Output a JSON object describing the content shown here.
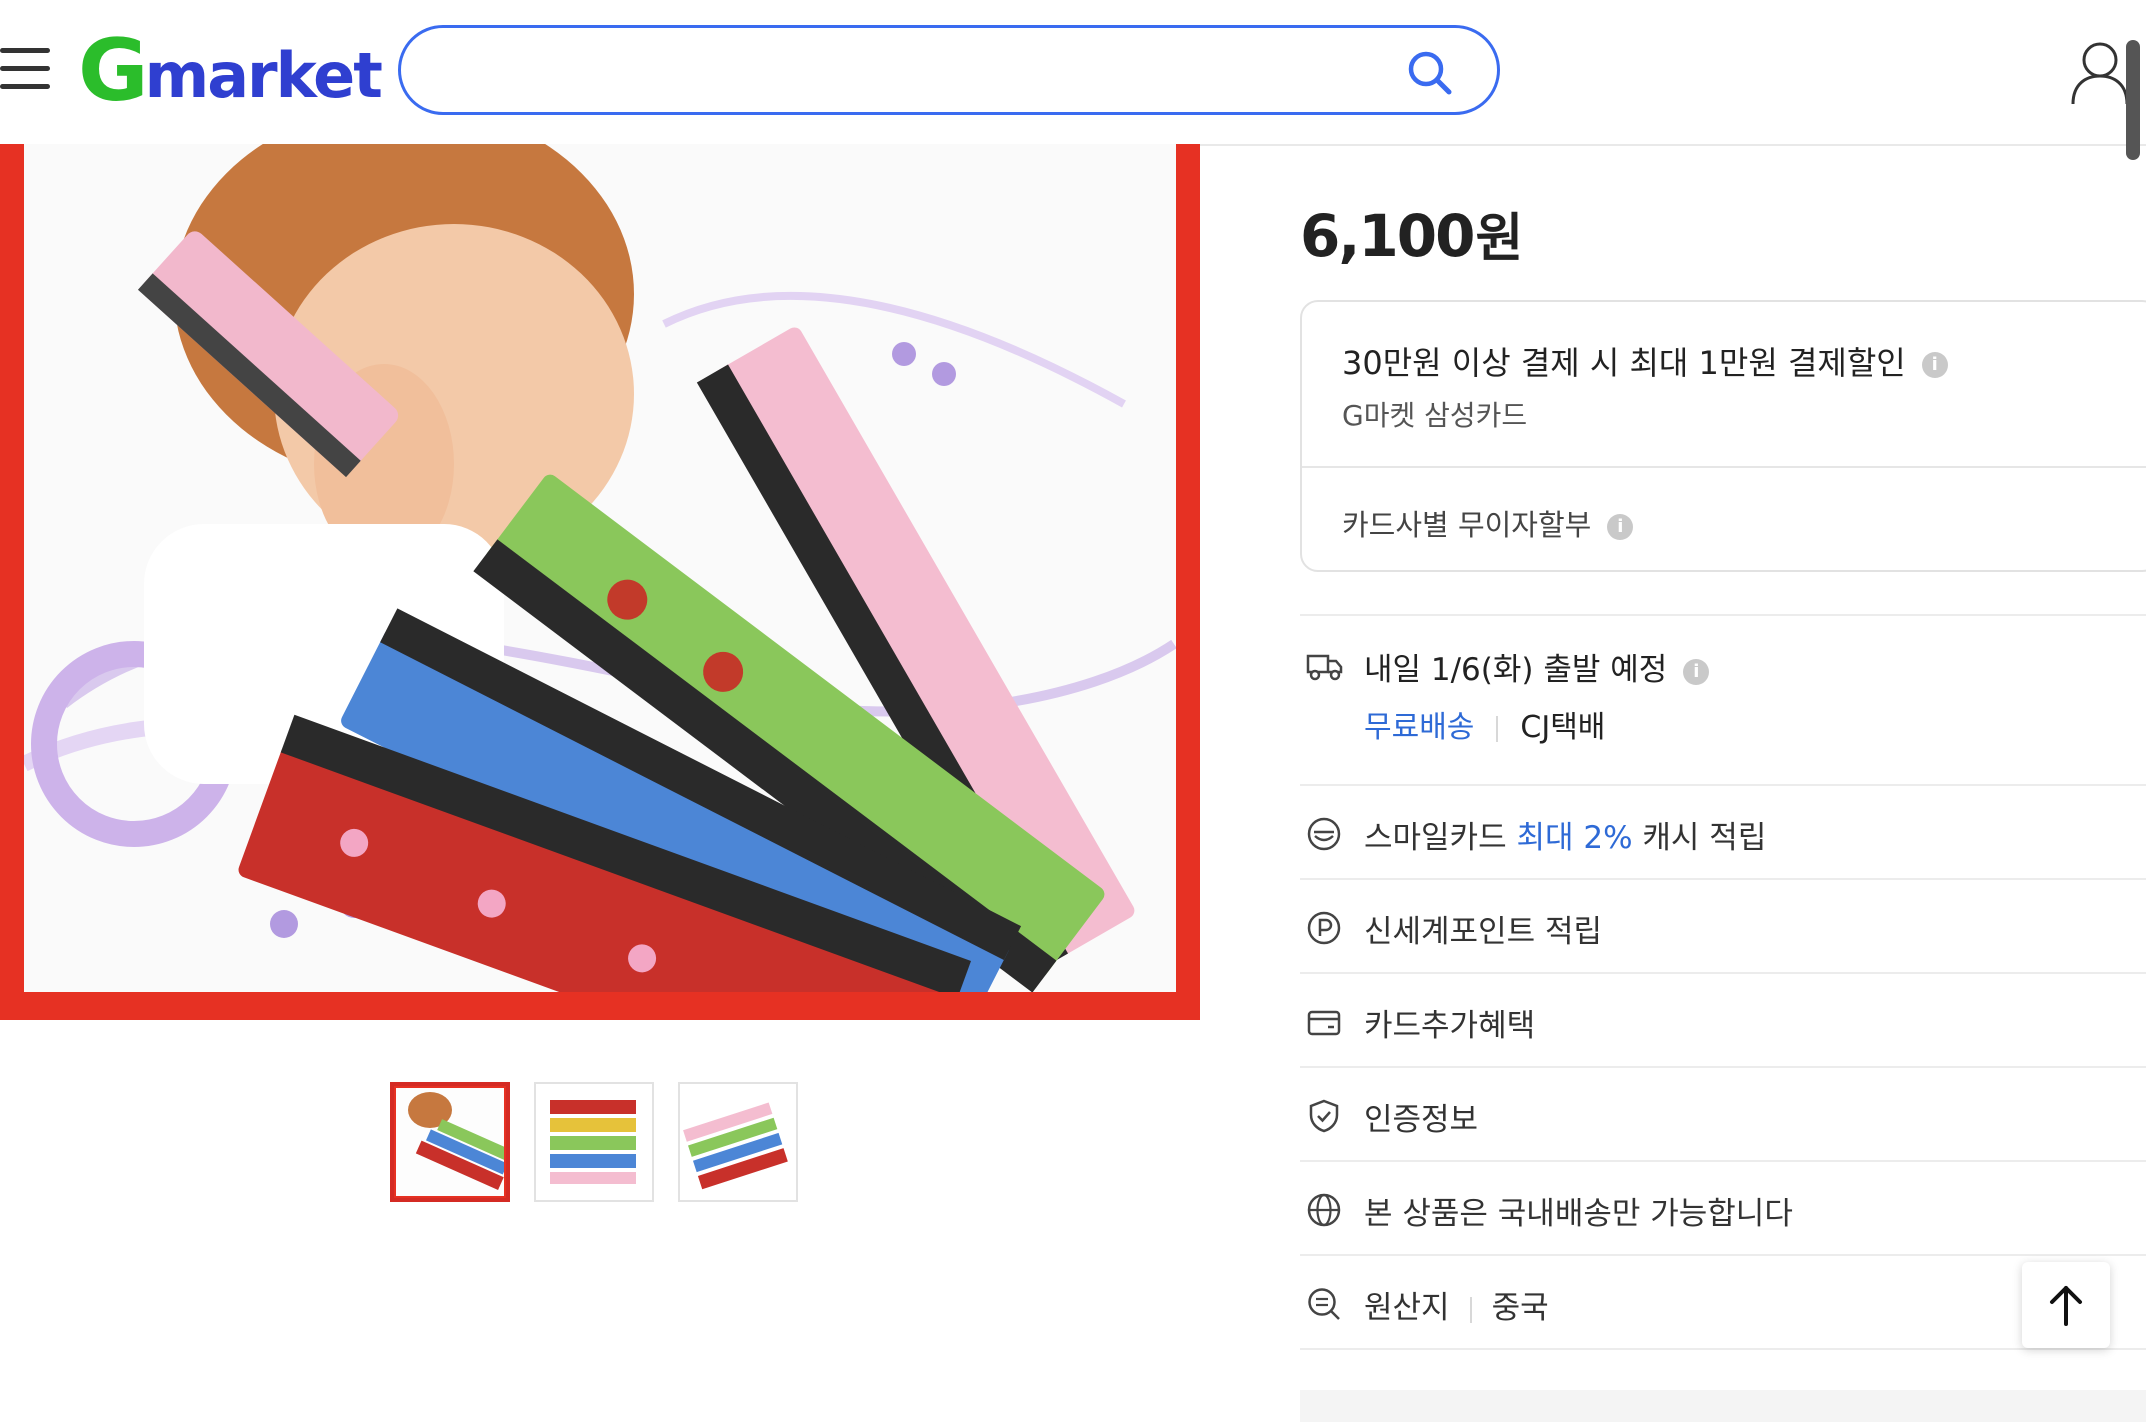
{
  "header": {
    "logo_g": "G",
    "logo_rest": "market",
    "search_placeholder": "",
    "search_value": ""
  },
  "product": {
    "price": "6,100",
    "currency": "원"
  },
  "card_promo": {
    "title": "30만원 이상 결제 시 최대 1만원 결제할인",
    "subtitle": "G마켓 삼성카드",
    "installment": "카드사별 무이자할부",
    "info_glyph": "i"
  },
  "shipping": {
    "title": "내일 1/6(화) 출발 예정",
    "free_label": "무료배송",
    "carrier": "CJ택배"
  },
  "benefits": [
    {
      "icon": "smile-card-icon",
      "prefix": "스마일카드 ",
      "highlight": "최대 2%",
      "suffix": " 캐시 적립"
    },
    {
      "icon": "point-icon",
      "prefix": "신세계포인트 적립",
      "highlight": "",
      "suffix": ""
    },
    {
      "icon": "card-icon",
      "prefix": "카드추가혜택",
      "highlight": "",
      "suffix": ""
    },
    {
      "icon": "shield-check-icon",
      "prefix": "인증정보",
      "highlight": "",
      "suffix": ""
    },
    {
      "icon": "globe-icon",
      "prefix": "본 상품은 국내배송만 가능합니다",
      "highlight": "",
      "suffix": ""
    }
  ],
  "origin": {
    "label": "원산지",
    "value": "중국"
  },
  "colors": {
    "accent_blue": "#2e6ad6",
    "search_border": "#3a6bf0",
    "logo_green": "#2bbd2b",
    "logo_blue": "#2f3fd0",
    "image_frame_red": "#e63123"
  }
}
